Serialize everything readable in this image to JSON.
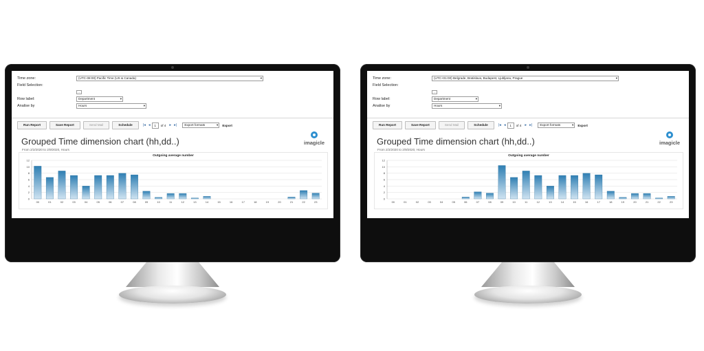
{
  "screens": [
    {
      "time_zone_label": "Time zone:",
      "time_zone_value": "(UTC-08:00) Pacific Time (US & Canada)",
      "field_selection_label": "Field Selection:",
      "field_selection_button": "...",
      "row_label_label": "Row label:",
      "row_label_value": "Department",
      "analise_by_label": "Analise by",
      "analise_by_value": "Hours",
      "buttons": {
        "run": "Run Report",
        "save": "Save Report",
        "mail": "Send Mail",
        "schedule": "Schedule"
      },
      "page": "1",
      "of_pages": "of 4",
      "export_formats": "Export formats",
      "export": "Export",
      "report_title": "Grouped Time dimension chart (hh,dd..)",
      "report_subtitle": "From 2/2/2020 to 2/9/2020, Hours",
      "logo": "imagicle",
      "chart_data": {
        "type": "bar",
        "title": "Outgoing average number",
        "categories": [
          "00",
          "01",
          "02",
          "03",
          "04",
          "05",
          "06",
          "07",
          "08",
          "09",
          "10",
          "11",
          "12",
          "13",
          "14",
          "15",
          "16",
          "17",
          "18",
          "19",
          "20",
          "21",
          "22",
          "23"
        ],
        "values": [
          10.2,
          6.7,
          8.7,
          7.3,
          4.0,
          7.3,
          7.3,
          8.0,
          7.5,
          2.4,
          0.5,
          1.7,
          1.7,
          0.3,
          0.8,
          0,
          0,
          0,
          0,
          0,
          0,
          0.6,
          2.6,
          1.8
        ],
        "ylim": [
          0,
          12
        ],
        "yticks": [
          "0",
          "2",
          "4",
          "6",
          "8",
          "10",
          "12"
        ],
        "grid": true
      }
    },
    {
      "time_zone_label": "Time zone:",
      "time_zone_value": "(UTC+01:00) Belgrade, Bratislava, Budapest, Ljubljana, Prague",
      "field_selection_label": "Field Selection:",
      "field_selection_button": "...",
      "row_label_label": "Row label:",
      "row_label_value": "Department",
      "analise_by_label": "Analise by",
      "analise_by_value": "Hours",
      "buttons": {
        "run": "Run Report",
        "save": "Save Report",
        "mail": "Send Mail",
        "schedule": "Schedule"
      },
      "page": "1",
      "of_pages": "of 4",
      "export_formats": "Export formats",
      "export": "Export",
      "report_title": "Grouped Time dimension chart (hh,dd..)",
      "report_subtitle": "From 2/2/2020 to 2/9/2020, Hours",
      "logo": "imagicle",
      "chart_data": {
        "type": "bar",
        "title": "Outgoing average number",
        "categories": [
          "00",
          "01",
          "02",
          "03",
          "04",
          "05",
          "06",
          "07",
          "08",
          "09",
          "10",
          "11",
          "12",
          "13",
          "14",
          "15",
          "16",
          "17",
          "18",
          "19",
          "20",
          "21",
          "22",
          "23"
        ],
        "values": [
          0,
          0,
          0,
          0,
          0,
          0,
          0.6,
          2.2,
          1.8,
          10.4,
          6.7,
          8.7,
          7.3,
          4.0,
          7.3,
          7.3,
          8.0,
          7.5,
          2.4,
          0.5,
          1.7,
          1.7,
          0.3,
          0.8
        ],
        "ylim": [
          0,
          12
        ],
        "yticks": [
          "0",
          "2",
          "4",
          "6",
          "8",
          "10",
          "12"
        ],
        "grid": true
      }
    }
  ]
}
